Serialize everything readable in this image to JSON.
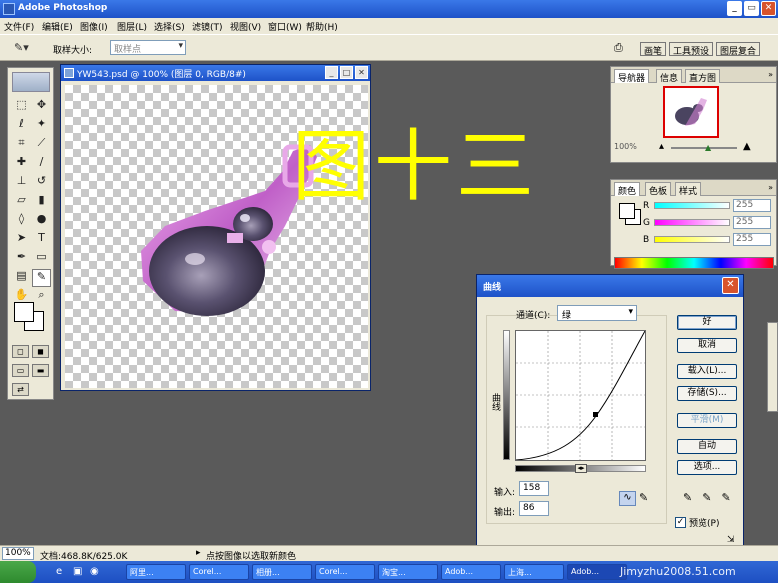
{
  "app": {
    "title": "Adobe Photoshop"
  },
  "menu": [
    "文件(F)",
    "编辑(E)",
    "图像(I)",
    "图层(L)",
    "选择(S)",
    "滤镜(T)",
    "视图(V)",
    "窗口(W)",
    "帮助(H)"
  ],
  "options": {
    "tool_icon": "eyedropper-icon",
    "sample_size_label": "取样大小:",
    "sample_size_value": "取样点"
  },
  "well_tabs": [
    "画笔",
    "工具预设",
    "图层复合"
  ],
  "document": {
    "title": "YW543.psd @ 100% (图层 0, RGB/8#)"
  },
  "annotation": {
    "text": "图十三",
    "color": "#ffff00"
  },
  "navigator": {
    "tabs": [
      "导航器",
      "信息",
      "直方图"
    ],
    "zoom": "100%"
  },
  "color_panel": {
    "tabs": [
      "颜色",
      "色板",
      "样式"
    ],
    "channels": [
      {
        "name": "R",
        "value": "255",
        "bar": "linear-gradient(90deg,#0ff,#fff)"
      },
      {
        "name": "G",
        "value": "255",
        "bar": "linear-gradient(90deg,#f0f,#fff)"
      },
      {
        "name": "B",
        "value": "255",
        "bar": "linear-gradient(90deg,#ff0,#fff)"
      }
    ]
  },
  "curves_dialog": {
    "title": "曲线",
    "channel_label": "通道(C):",
    "channel_value": "绿",
    "vertical_label": "曲线",
    "input_label": "输入:",
    "input_value": "158",
    "output_label": "输出:",
    "output_value": "86",
    "buttons": {
      "ok": "好",
      "cancel": "取消",
      "load": "载入(L)...",
      "save": "存储(S)...",
      "smooth": "平滑(M)",
      "auto": "自动",
      "options": "选项..."
    },
    "preview_label": "预览(P)",
    "preview_checked": true
  },
  "status": {
    "zoom": "100%",
    "doc_size": "文档:468.8K/625.0K",
    "hint": "点按图像以选取新颜色"
  },
  "taskbar": {
    "tasks": [
      "阿里...",
      "Corel...",
      "相册...",
      "Corel...",
      "淘宝...",
      "Adob...",
      "上海...",
      "Adob..."
    ],
    "watermark": "Jimyzhu2008.51.com"
  }
}
